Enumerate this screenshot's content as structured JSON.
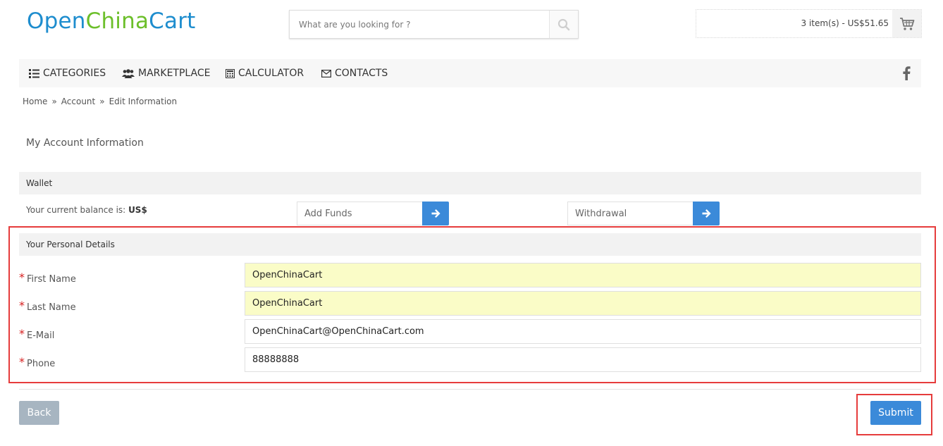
{
  "logo": {
    "part1": "Open",
    "part2": "China",
    "part3": "Cart"
  },
  "search": {
    "placeholder": "What are you looking for ?"
  },
  "cart": {
    "summary": "3 item(s) - US$51.65"
  },
  "nav": {
    "items": [
      {
        "label": "CATEGORIES",
        "icon": "list-icon"
      },
      {
        "label": "MARKETPLACE",
        "icon": "users-icon"
      },
      {
        "label": "CALCULATOR",
        "icon": "calculator-icon"
      },
      {
        "label": "CONTACTS",
        "icon": "envelope-icon"
      }
    ],
    "social_icon": "facebook-icon"
  },
  "breadcrumb": {
    "items": [
      "Home",
      "Account",
      "Edit Information"
    ],
    "separator": "»"
  },
  "page": {
    "title": "My Account Information"
  },
  "wallet": {
    "heading": "Wallet",
    "balance_label": "Your current balance is:",
    "balance_value": "US$",
    "add_funds_placeholder": "Add Funds",
    "withdrawal_placeholder": "Withdrawal"
  },
  "personal": {
    "heading": "Your Personal Details",
    "required_mark": "*",
    "fields": [
      {
        "label": "First Name",
        "value": "OpenChinaCart"
      },
      {
        "label": "Last Name",
        "value": "OpenChinaCart"
      },
      {
        "label": "E-Mail",
        "value": "OpenChinaCart@OpenChinaCart.com"
      },
      {
        "label": "Phone",
        "value": "88888888"
      }
    ]
  },
  "actions": {
    "back_label": "Back",
    "submit_label": "Submit"
  },
  "colors": {
    "accent_blue": "#3b8ad9",
    "highlight_red": "#e63c3c",
    "autofill_yellow": "#fafcc7",
    "back_gray": "#a7b5c1"
  }
}
